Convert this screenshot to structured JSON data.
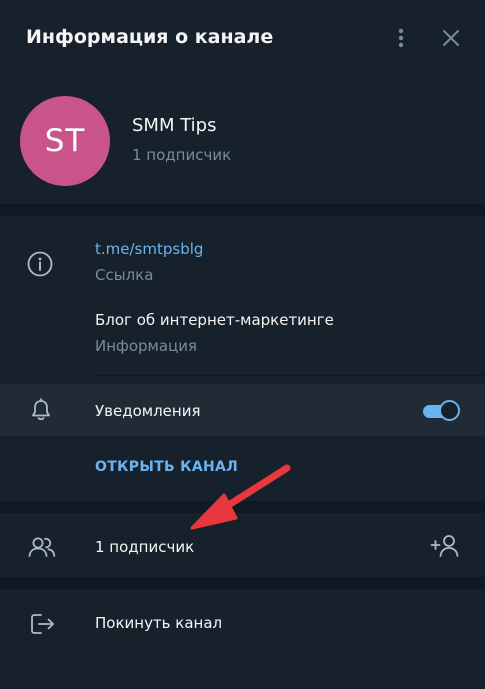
{
  "header": {
    "title": "Информация о канале"
  },
  "channel": {
    "avatar_initials": "ST",
    "name": "SMM Tips",
    "subscribers": "1 подписчик"
  },
  "info": {
    "link_value": "t.me/smtpsblg",
    "link_label": "Ссылка",
    "description_value": "Блог об интернет-маркетинге",
    "description_label": "Информация"
  },
  "notifications": {
    "label": "Уведомления",
    "enabled": true
  },
  "actions": {
    "open_channel": "ОТКРЫТЬ КАНАЛ",
    "subscribers_row": "1 подписчик",
    "leave_channel": "Покинуть канал"
  },
  "colors": {
    "background": "#17212b",
    "divider": "#101821",
    "accent": "#6ab2f2",
    "avatar": "#c9548a",
    "secondary_text": "#768c9e",
    "annotation_arrow": "#e8383d"
  },
  "icons": {
    "menu": "more-vertical-icon",
    "close": "close-icon",
    "info": "info-circle-icon",
    "bell": "bell-icon",
    "users": "users-icon",
    "add_user": "add-user-icon",
    "leave": "logout-icon"
  }
}
